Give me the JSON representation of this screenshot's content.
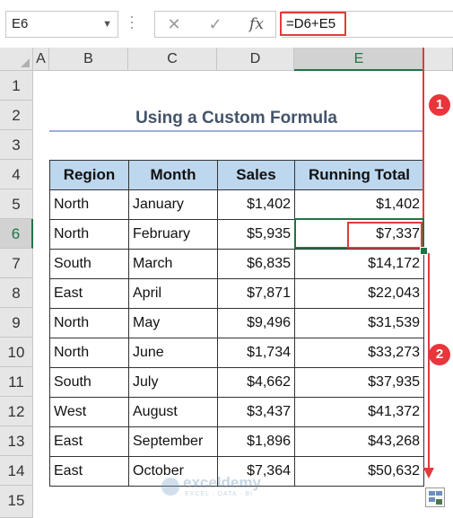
{
  "formula_bar": {
    "name_box": "E6",
    "cancel_icon": "close-icon",
    "enter_icon": "check-icon",
    "fx_label": "fx",
    "formula": "=D6+E5"
  },
  "columns": [
    "A",
    "B",
    "C",
    "D",
    "E"
  ],
  "rows": [
    "1",
    "2",
    "3",
    "4",
    "5",
    "6",
    "7",
    "8",
    "9",
    "10",
    "11",
    "12",
    "13",
    "14",
    "15"
  ],
  "selected_cell": "E6",
  "title": "Using a Custom Formula",
  "table": {
    "headers": [
      "Region",
      "Month",
      "Sales",
      "Running Total"
    ],
    "rows": [
      [
        "North",
        "January",
        "$1,402",
        "$1,402"
      ],
      [
        "North",
        "February",
        "$5,935",
        "$7,337"
      ],
      [
        "South",
        "March",
        "$6,835",
        "$14,172"
      ],
      [
        "East",
        "April",
        "$7,871",
        "$22,043"
      ],
      [
        "North",
        "May",
        "$9,496",
        "$31,539"
      ],
      [
        "North",
        "June",
        "$1,734",
        "$33,273"
      ],
      [
        "South",
        "July",
        "$4,662",
        "$37,935"
      ],
      [
        "West",
        "August",
        "$3,437",
        "$41,372"
      ],
      [
        "East",
        "September",
        "$1,896",
        "$43,268"
      ],
      [
        "East",
        "October",
        "$7,364",
        "$50,632"
      ]
    ]
  },
  "annotations": {
    "step1": "1",
    "step2": "2",
    "accent_color": "#e03c3c"
  },
  "watermark": {
    "name": "exceldemy",
    "tagline": "EXCEL · DATA · BI"
  }
}
